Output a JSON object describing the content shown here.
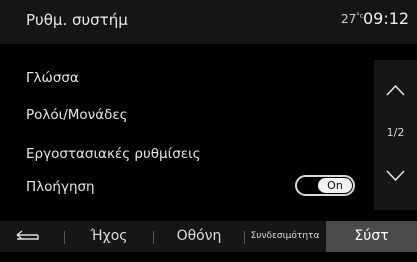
{
  "header": {
    "title": "Ρυθμ. συστήμ",
    "temperature": "27",
    "temperature_unit": "°c",
    "time": "09:12"
  },
  "menu": {
    "items": [
      {
        "label": "Γλώσσα"
      },
      {
        "label": "Ρολόι/Μονάδες"
      },
      {
        "label": "Εργοστασιακές ρυθμίσεις"
      },
      {
        "label": "Πλοήγηση"
      }
    ],
    "toggle": {
      "label": "On",
      "state": "on"
    }
  },
  "scroll": {
    "page": "1/2",
    "up_icon": "chevron-up-icon",
    "down_icon": "chevron-down-icon"
  },
  "bottom_bar": {
    "back_icon": "back-arrow-icon",
    "tabs": [
      {
        "label": "Ήχος"
      },
      {
        "label": "Οθόνη"
      },
      {
        "label": "Συνδεσιμότητα"
      },
      {
        "label": "Σύστ",
        "active": true
      }
    ]
  },
  "colors": {
    "background": "#000000",
    "bar": "#161616",
    "active_tab": "#4a4a4a",
    "text": "#e6e6e6"
  }
}
